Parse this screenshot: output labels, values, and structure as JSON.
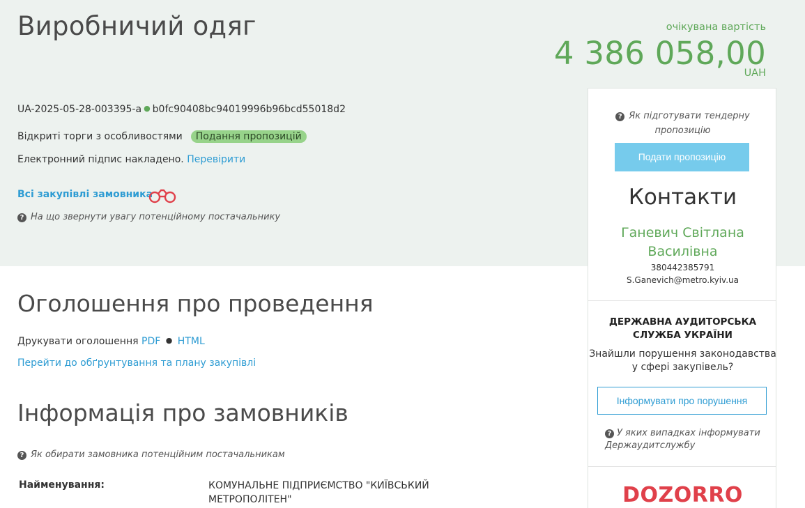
{
  "tender": {
    "title": "Виробничий одяг",
    "expected_cost_label": "очікувана вартість",
    "expected_cost": "4 386 058,00",
    "currency": "UAH",
    "id": "UA-2025-05-28-003395-a",
    "hash": "b0fc90408bc94019996b96bcd55018d2",
    "procedure": "Відкриті торги з особливостями",
    "status": "Подання пропозицій",
    "signature_text": "Електронний підпис накладено.",
    "signature_check": "Перевірити",
    "all_buyer_purchases": "Всі закупівлі замовника",
    "hint_attention": "На що звернути увагу потенційному постачальнику"
  },
  "announcement": {
    "heading": "Оголошення про проведення",
    "print_label": "Друкувати оголошення",
    "pdf": "PDF",
    "html": "HTML",
    "plan_link": "Перейти до обґрунтування та плану закупівлі"
  },
  "buyers": {
    "heading": "Інформація про замовників",
    "hint_choose": "Як обирати замовника потенційним постачальникам",
    "name_label": "Найменування:",
    "name_value": "КОМУНАЛЬНЕ ПІДПРИЄМСТВО \"КИЇВСЬКИЙ МЕТРОПОЛІТЕН\""
  },
  "sidebar": {
    "hint_prepare": "Як підготувати тендерну пропозицію",
    "submit_button": "Подати пропозицію",
    "contacts_heading": "Контакти",
    "contact_name": "Ганевич Світлана Василівна",
    "contact_phone": "380442385791",
    "contact_email": "S.Ganevich@metro.kyiv.ua",
    "audit_heading": "ДЕРЖАВНА АУДИТОРСЬКА СЛУЖБА УКРАЇНИ",
    "audit_question": "Знайшли порушення законодавства у сфері закупівель?",
    "inform_button": "Інформувати про порушення",
    "hint_when": "У яких випадках інформувати Держаудитслужбу",
    "dozorro_logo": "DOZORRO"
  },
  "colors": {
    "accent_green": "#5fa859",
    "link_blue": "#2e9cd3",
    "submit_button_bg": "#76cbec",
    "status_badge_bg": "#97d38a",
    "hero_bg": "#edf2ef",
    "dozorro_red": "#e0404a"
  },
  "icons": {
    "hint": "question-circle-icon",
    "watch": "binoculars-icon"
  }
}
